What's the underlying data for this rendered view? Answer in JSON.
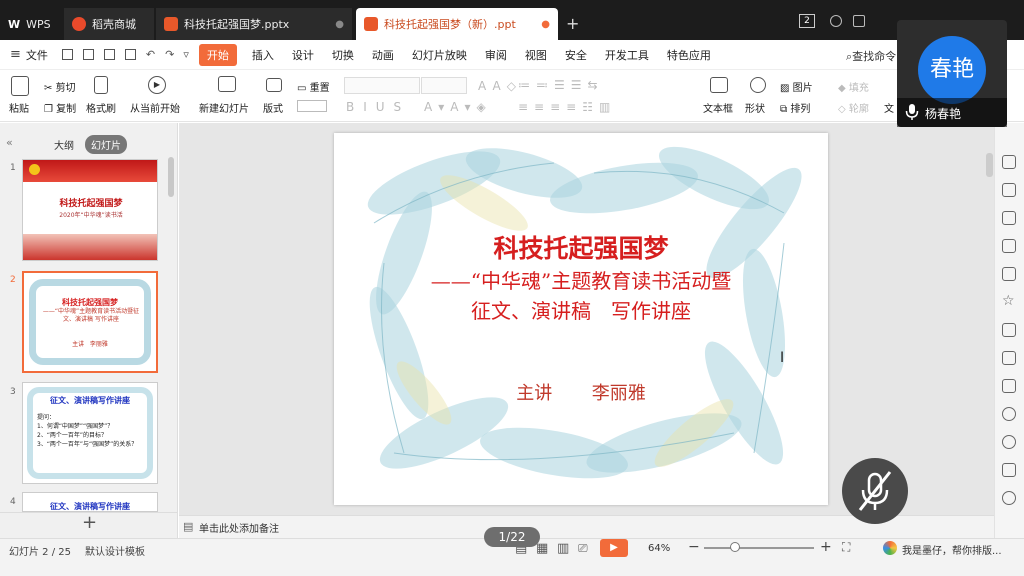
{
  "titlebar": {
    "tabs": [
      {
        "label": "WPS"
      },
      {
        "label": "稻壳商城"
      },
      {
        "label": "科技托起强国梦.pptx"
      },
      {
        "label": "科技托起强国梦（新）.ppt"
      }
    ],
    "badge": "2"
  },
  "menu": {
    "file": "文件",
    "items": [
      "开始",
      "插入",
      "设计",
      "切换",
      "动画",
      "幻灯片放映",
      "审阅",
      "视图",
      "安全",
      "开发工具",
      "特色应用"
    ],
    "search": "查找命令"
  },
  "ribbon": {
    "paste": "粘贴",
    "cut": "剪切",
    "copy": "复制",
    "format_painter": "格式刷",
    "from_current": "从当前开始",
    "new_slide": "新建幻灯片",
    "layout": "版式",
    "reset": "重置",
    "textbox": "文本框",
    "shape": "形状",
    "picture": "图片",
    "arrange": "排列",
    "fill": "填充",
    "outline": "轮廓",
    "text_cut": "文"
  },
  "left_panel": {
    "tab_outline": "大纲",
    "tab_slides": "幻灯片",
    "thumbs": [
      {
        "num": "1",
        "title": "科技托起强国梦",
        "sub": "2020年“中华魂”读书活"
      },
      {
        "num": "2",
        "title": "科技托起强国梦",
        "sub": "——“中华魂”主题教育读书活动暨征文、演讲稿 写作讲座",
        "speaker": "主讲   李丽雅"
      },
      {
        "num": "3",
        "title": "征文、演讲稿写作讲座",
        "lines": [
          "提问：",
          "1、何谓“中国梦”“强国梦”？",
          "2、“两个一百年”的目标？",
          "3、“两个一百年”与“强国梦”的关系？"
        ]
      },
      {
        "num": "4",
        "title": "征文、演讲稿写作讲座"
      }
    ]
  },
  "slide": {
    "title": "科技托起强国梦",
    "subtitle_line1": "——“中华魂”主题教育读书活动暨",
    "subtitle_line2": "征文、演讲稿　写作讲座",
    "speaker_label": "主讲",
    "speaker_name": "李丽雅"
  },
  "notes": {
    "placeholder": "单击此处添加备注"
  },
  "status": {
    "slide_pos": "幻灯片 2 / 25",
    "template": "默认设计模板",
    "page_pill": "1/22",
    "zoom": "64%",
    "assistant": "我是墨仔，帮你排版..."
  },
  "video": {
    "avatar_text": "春艳",
    "name": "杨春艳"
  },
  "colors": {
    "accent": "#f26b3a",
    "slide_title": "#d61f1f",
    "speaker": "#c0392b"
  }
}
